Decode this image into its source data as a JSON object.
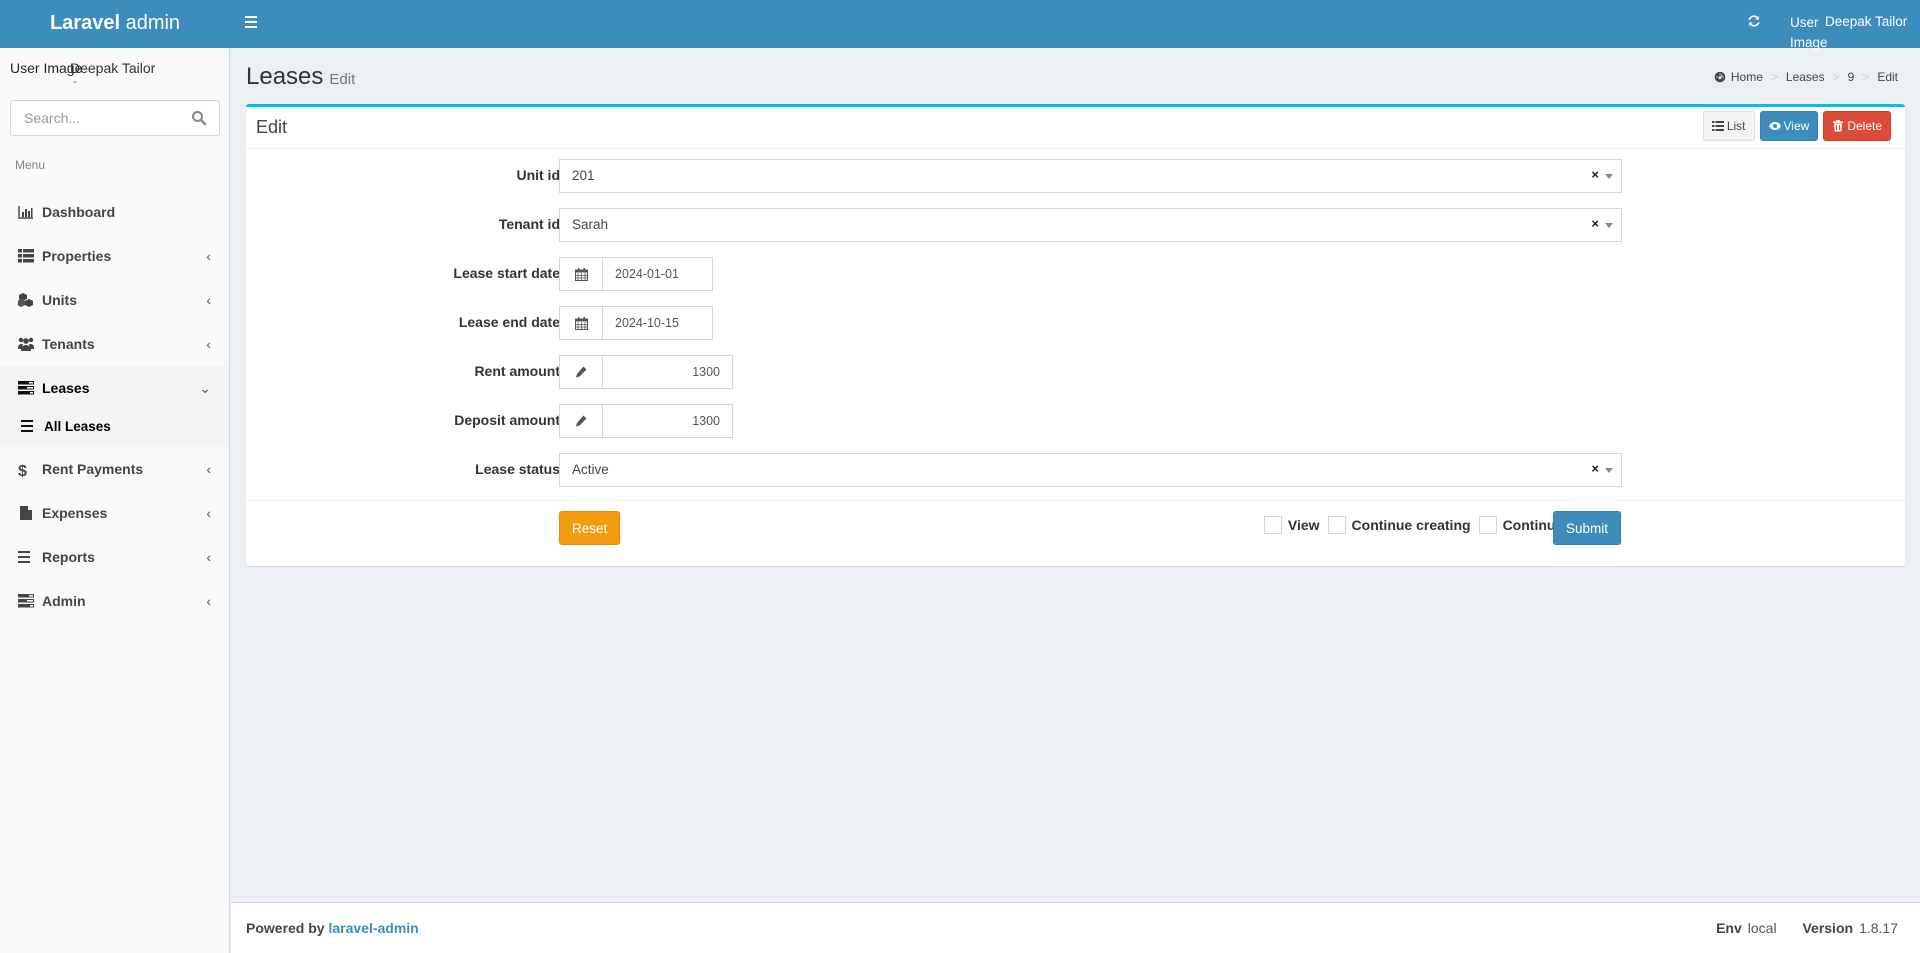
{
  "header": {
    "logo_bold": "Laravel",
    "logo_light": " admin",
    "user_image_alt": "User Image",
    "user_name": "Deepak Tailor"
  },
  "sidebar": {
    "user_image_alt": "User Image",
    "user_name": "Deepak Tailor",
    "user_status": "-",
    "search_placeholder": "Search...",
    "menu_header": "Menu",
    "items": [
      {
        "label": "Dashboard",
        "icon": "bar-chart-icon",
        "has_children": false
      },
      {
        "label": "Properties",
        "icon": "list-icon",
        "has_children": true
      },
      {
        "label": "Units",
        "icon": "cubes-icon",
        "has_children": true
      },
      {
        "label": "Tenants",
        "icon": "users-icon",
        "has_children": true
      },
      {
        "label": "Leases",
        "icon": "tasks-icon",
        "has_children": true,
        "expanded": true,
        "children": [
          {
            "label": "All Leases",
            "icon": "bars-icon"
          }
        ]
      },
      {
        "label": "Rent Payments",
        "icon": "dollar-icon",
        "has_children": true
      },
      {
        "label": "Expenses",
        "icon": "file-icon",
        "has_children": true
      },
      {
        "label": "Reports",
        "icon": "bars-icon",
        "has_children": true
      },
      {
        "label": "Admin",
        "icon": "tasks-icon",
        "has_children": true
      }
    ]
  },
  "content": {
    "title": "Leases",
    "subtitle": "Edit",
    "breadcrumb": [
      "Home",
      "Leases",
      "9",
      "Edit"
    ]
  },
  "box": {
    "title": "Edit",
    "tools": {
      "list": "List",
      "view": "View",
      "delete": "Delete"
    },
    "fields": {
      "unit_id": {
        "label": "Unit id",
        "value": "201"
      },
      "tenant_id": {
        "label": "Tenant id",
        "value": "Sarah"
      },
      "lease_start_date": {
        "label": "Lease start date",
        "value": "2024-01-01"
      },
      "lease_end_date": {
        "label": "Lease end date",
        "value": "2024-10-15"
      },
      "rent_amount": {
        "label": "Rent amount",
        "value": "1300"
      },
      "deposit_amount": {
        "label": "Deposit amount",
        "value": "1300"
      },
      "lease_status": {
        "label": "Lease status",
        "value": "Active"
      }
    },
    "footer": {
      "reset": "Reset",
      "checks": {
        "view": "View",
        "continue_creating": "Continue creating",
        "continue_editing": "Continue editing"
      },
      "submit": "Submit"
    }
  },
  "footer": {
    "powered_by": "Powered by ",
    "link": "laravel-admin",
    "env_label": "Env",
    "env_value": "local",
    "version_label": "Version",
    "version_value": "1.8.17"
  },
  "colors": {
    "brand": "#3c8dbc",
    "box_border": "#00c0ef",
    "danger": "#dd4b39",
    "warning": "#f39c12"
  }
}
